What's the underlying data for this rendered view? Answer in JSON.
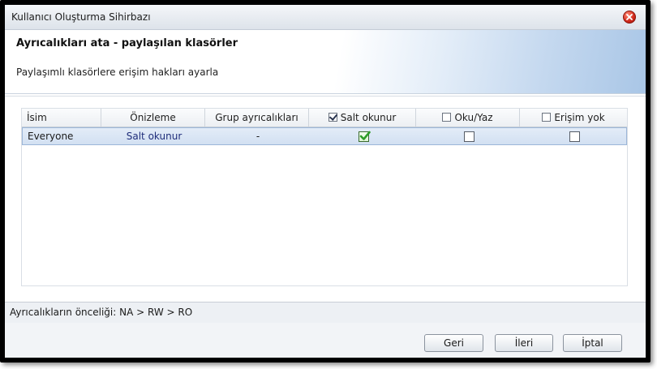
{
  "window": {
    "title": "Kullanıcı Oluşturma Sihirbazı",
    "close_icon": "close-icon"
  },
  "header": {
    "title": "Ayrıcalıkları ata - paylaşılan klasörler",
    "subtitle": "Paylaşımlı klasörlere erişim hakları ayarla"
  },
  "table": {
    "columns": {
      "name": "İsim",
      "preview": "Önizleme",
      "group": "Grup ayrıcalıkları",
      "readonly": "Salt okunur",
      "readwrite": "Oku/Yaz",
      "noaccess": "Erişim yok"
    },
    "header_checks": {
      "readonly": true,
      "readwrite": false,
      "noaccess": false
    },
    "rows": [
      {
        "name": "Everyone",
        "preview": "Salt okunur",
        "group": "-",
        "readonly": true,
        "readwrite": false,
        "noaccess": false
      }
    ]
  },
  "footer": {
    "priority_note": "Ayrıcalıkların önceliği: NA > RW > RO"
  },
  "buttons": {
    "back": "Geri",
    "next": "İleri",
    "cancel": "İptal"
  },
  "colors": {
    "accent": "#a9c6e6",
    "selected_row": "#d2e0f2",
    "close": "#d0281a",
    "check_green": "#2f9e2a"
  }
}
